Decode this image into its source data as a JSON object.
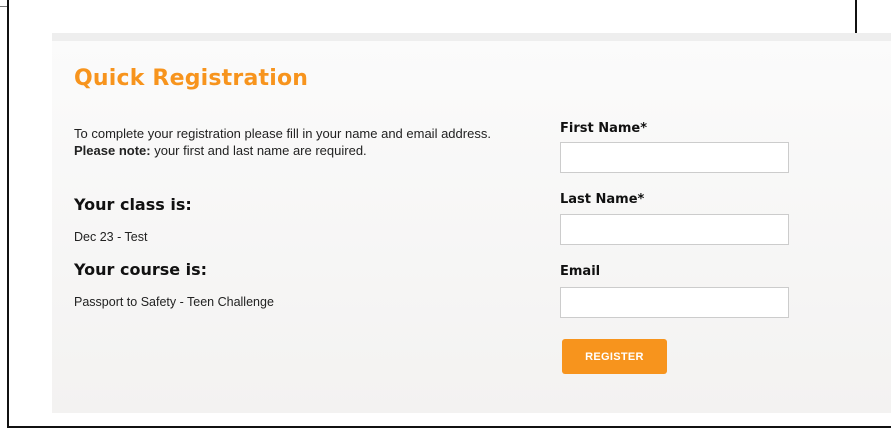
{
  "panel": {
    "title": "Quick Registration",
    "intro_text": "To complete your registration please fill in your name and email address.",
    "intro_note_label": "Please note:",
    "intro_note_text": "your first and last name are required.",
    "class_heading": "Your class is:",
    "class_value": "Dec 23 - Test",
    "course_heading": "Your course is:",
    "course_value": "Passport to Safety - Teen Challenge"
  },
  "form": {
    "first_name_label": "First Name*",
    "first_name_value": "",
    "last_name_label": "Last Name*",
    "last_name_value": "",
    "email_label": "Email",
    "email_value": "",
    "register_label": "REGISTER"
  },
  "colors": {
    "accent": "#f7941d",
    "panel_bg": "#f5f4f3",
    "text": "#222222"
  }
}
